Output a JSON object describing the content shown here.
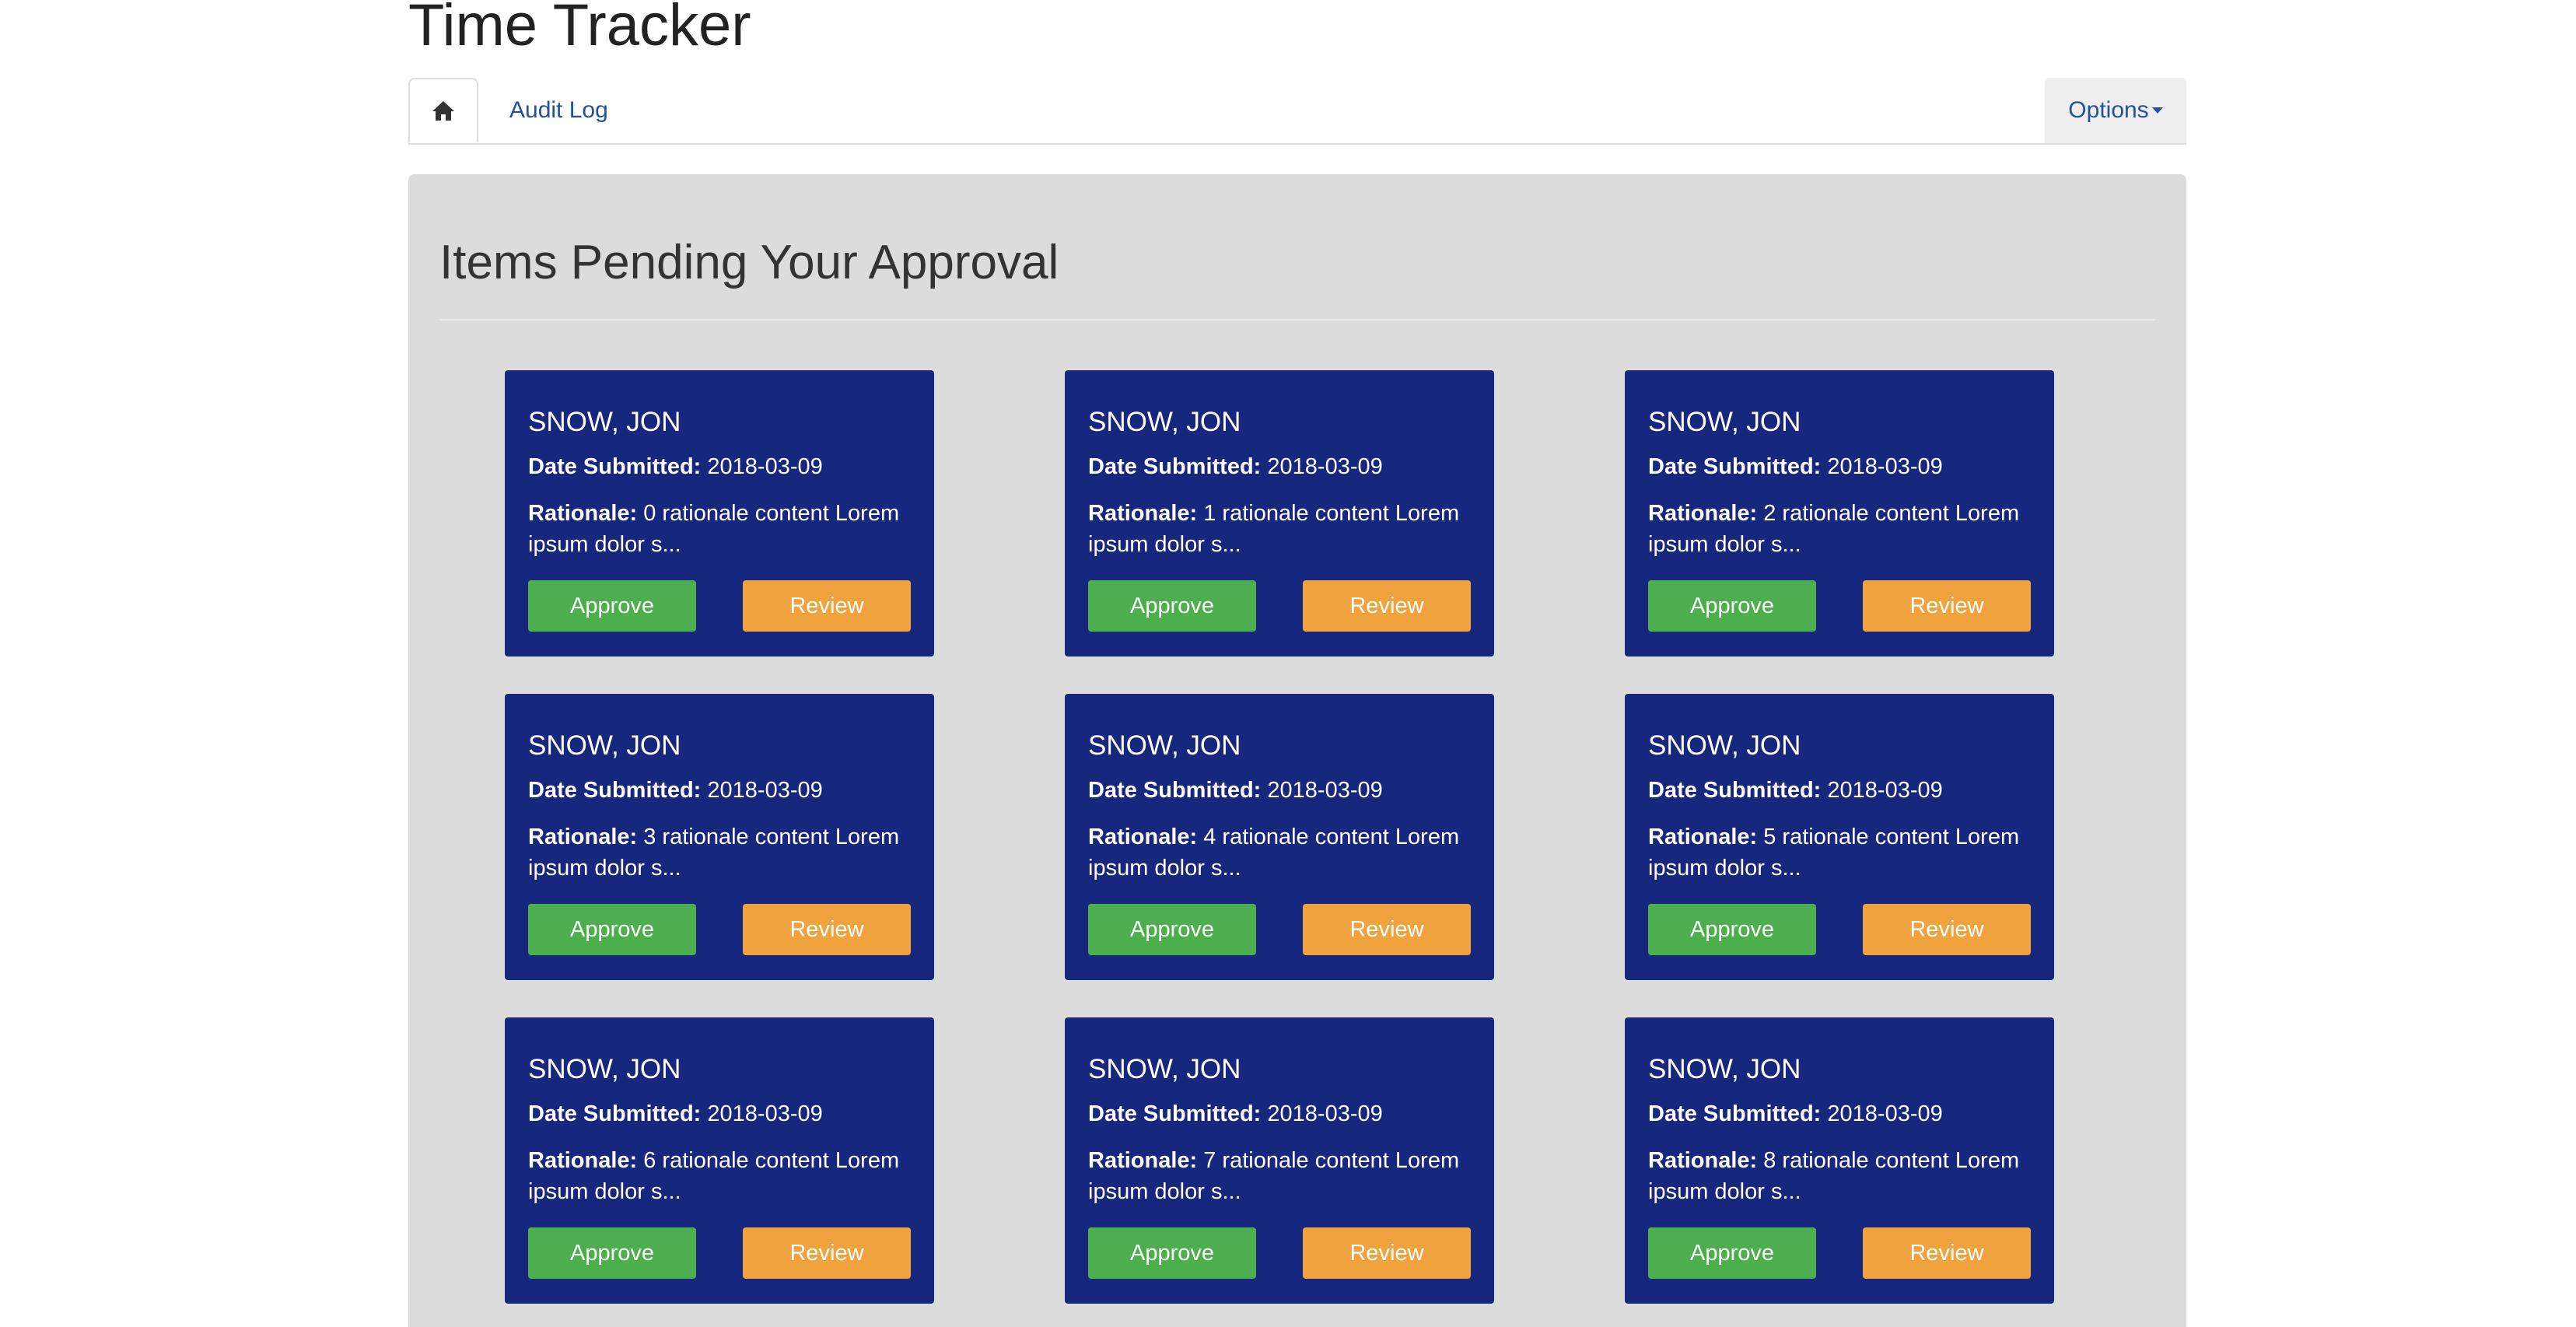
{
  "app": {
    "title": "Time Tracker"
  },
  "nav": {
    "home_icon": "home-icon",
    "tabs": [
      {
        "label": "Audit Log"
      }
    ],
    "options_label": "Options"
  },
  "main": {
    "heading": "Items Pending Your Approval",
    "date_label": "Date Submitted:",
    "rationale_label": "Rationale:",
    "approve_label": "Approve",
    "review_label": "Review",
    "items": [
      {
        "name": "SNOW, JON",
        "date": "2018-03-09",
        "rationale": "0 rationale content Lorem ipsum dolor s..."
      },
      {
        "name": "SNOW, JON",
        "date": "2018-03-09",
        "rationale": "1 rationale content Lorem ipsum dolor s..."
      },
      {
        "name": "SNOW, JON",
        "date": "2018-03-09",
        "rationale": "2 rationale content Lorem ipsum dolor s..."
      },
      {
        "name": "SNOW, JON",
        "date": "2018-03-09",
        "rationale": "3 rationale content Lorem ipsum dolor s..."
      },
      {
        "name": "SNOW, JON",
        "date": "2018-03-09",
        "rationale": "4 rationale content Lorem ipsum dolor s..."
      },
      {
        "name": "SNOW, JON",
        "date": "2018-03-09",
        "rationale": "5 rationale content Lorem ipsum dolor s..."
      },
      {
        "name": "SNOW, JON",
        "date": "2018-03-09",
        "rationale": "6 rationale content Lorem ipsum dolor s..."
      },
      {
        "name": "SNOW, JON",
        "date": "2018-03-09",
        "rationale": "7 rationale content Lorem ipsum dolor s..."
      },
      {
        "name": "SNOW, JON",
        "date": "2018-03-09",
        "rationale": "8 rationale content Lorem ipsum dolor s..."
      }
    ]
  },
  "colors": {
    "card_bg": "#17277e",
    "approve": "#4cae4c",
    "review": "#f0a23e",
    "panel_bg": "#dcdcdc",
    "link": "#22529a"
  }
}
